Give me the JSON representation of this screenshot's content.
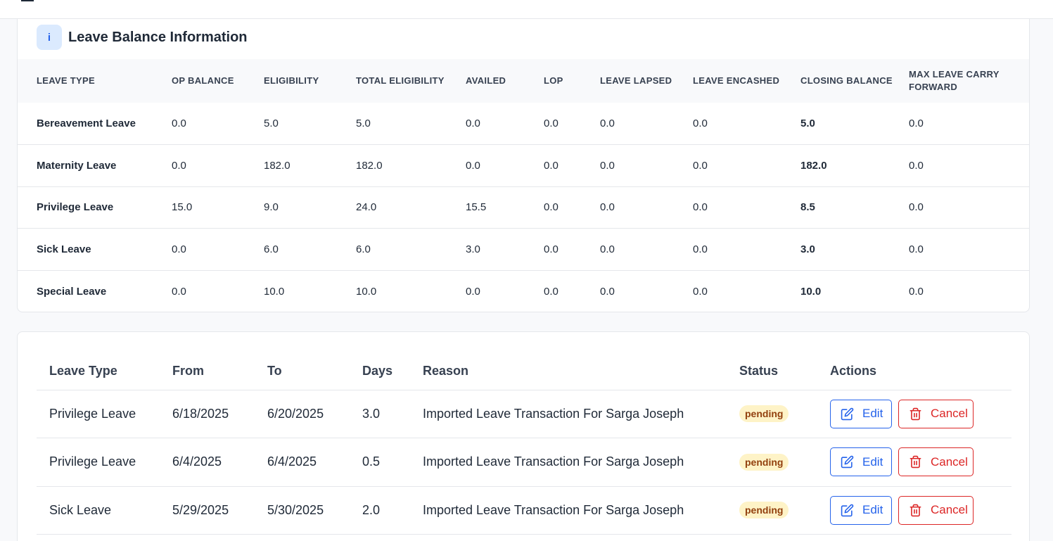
{
  "colors": {
    "accent_blue": "#2563eb",
    "danger_red": "#dc2626",
    "pending_bg": "#fef3c7",
    "pending_text": "#92400e",
    "info_icon_bg": "#dbeafe"
  },
  "balance": {
    "icon_glyph": "i",
    "title": "Leave Balance Information",
    "headers": [
      "LEAVE TYPE",
      "OP BALANCE",
      "ELIGIBILITY",
      "TOTAL ELIGIBILITY",
      "AVAILED",
      "LOP",
      "LEAVE LAPSED",
      "LEAVE ENCASHED",
      "CLOSING BALANCE",
      "MAX LEAVE CARRY FORWARD"
    ],
    "rows": [
      [
        "Bereavement Leave",
        "0.0",
        "5.0",
        "5.0",
        "0.0",
        "0.0",
        "0.0",
        "0.0",
        "5.0",
        "0.0"
      ],
      [
        "Maternity Leave",
        "0.0",
        "182.0",
        "182.0",
        "0.0",
        "0.0",
        "0.0",
        "0.0",
        "182.0",
        "0.0"
      ],
      [
        "Privilege Leave",
        "15.0",
        "9.0",
        "24.0",
        "15.5",
        "0.0",
        "0.0",
        "0.0",
        "8.5",
        "0.0"
      ],
      [
        "Sick Leave",
        "0.0",
        "6.0",
        "6.0",
        "3.0",
        "0.0",
        "0.0",
        "0.0",
        "3.0",
        "0.0"
      ],
      [
        "Special Leave",
        "0.0",
        "10.0",
        "10.0",
        "0.0",
        "0.0",
        "0.0",
        "0.0",
        "10.0",
        "0.0"
      ]
    ]
  },
  "transactions": {
    "headers": [
      "Leave Type",
      "From",
      "To",
      "Days",
      "Reason",
      "Status",
      "Actions"
    ],
    "edit_label": "Edit",
    "cancel_label": "Cancel",
    "rows": [
      {
        "leave_type": "Privilege Leave",
        "from": "6/18/2025",
        "to": "6/20/2025",
        "days": "3.0",
        "reason": "Imported Leave Transaction For Sarga Joseph",
        "status": "pending"
      },
      {
        "leave_type": "Privilege Leave",
        "from": "6/4/2025",
        "to": "6/4/2025",
        "days": "0.5",
        "reason": "Imported Leave Transaction For Sarga Joseph",
        "status": "pending"
      },
      {
        "leave_type": "Sick Leave",
        "from": "5/29/2025",
        "to": "5/30/2025",
        "days": "2.0",
        "reason": "Imported Leave Transaction For Sarga Joseph",
        "status": "pending"
      }
    ]
  }
}
